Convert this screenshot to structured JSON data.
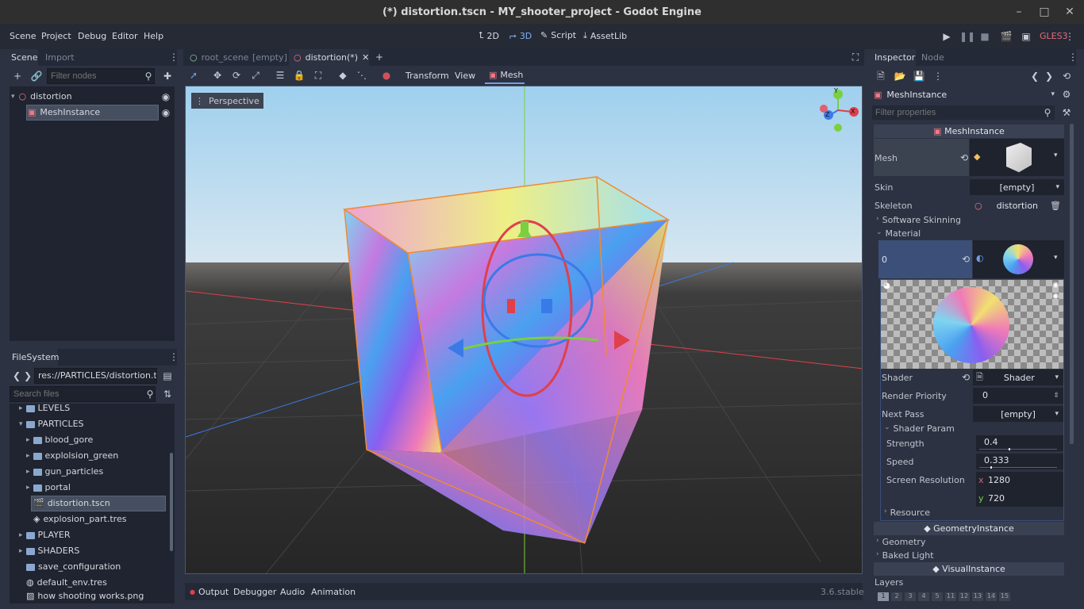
{
  "window": {
    "title": "(*) distortion.tscn - MY_shooter_project - Godot Engine",
    "controls": [
      "–",
      "□",
      "✕"
    ]
  },
  "menu": {
    "items": [
      "Scene",
      "Project",
      "Debug",
      "Editor",
      "Help"
    ]
  },
  "modes": {
    "d2": "2D",
    "d3": "3D",
    "script": "Script",
    "assetlib": "AssetLib"
  },
  "renderer": "GLES3",
  "scene_panel": {
    "tab_scene": "Scene",
    "tab_import": "Import",
    "filter_placeholder": "Filter nodes",
    "nodes": [
      {
        "name": "distortion"
      },
      {
        "name": "MeshInstance"
      }
    ]
  },
  "filesystem": {
    "tab": "FileSystem",
    "path": "res://PARTICLES/distortion.tscn",
    "search_placeholder": "Search files",
    "items": [
      {
        "name": "LEVELS",
        "type": "folder"
      },
      {
        "name": "PARTICLES",
        "type": "folder"
      },
      {
        "name": "blood_gore",
        "type": "folder"
      },
      {
        "name": "explolsion_green",
        "type": "folder"
      },
      {
        "name": "gun_particles",
        "type": "folder"
      },
      {
        "name": "portal",
        "type": "folder"
      },
      {
        "name": "distortion.tscn",
        "type": "scene"
      },
      {
        "name": "explosion_part.tres",
        "type": "resource"
      },
      {
        "name": "PLAYER",
        "type": "folder"
      },
      {
        "name": "SHADERS",
        "type": "folder"
      },
      {
        "name": "save_configuration",
        "type": "folder"
      },
      {
        "name": "default_env.tres",
        "type": "resource"
      },
      {
        "name": "how shooting works.png",
        "type": "image"
      }
    ]
  },
  "editor_tabs": [
    {
      "label": "root_scene"
    },
    {
      "label": "[empty]"
    },
    {
      "label": "distortion(*)"
    }
  ],
  "viewport_toolbar": {
    "transform": "Transform",
    "view": "View",
    "mesh": "Mesh"
  },
  "viewport": {
    "perspective": "Perspective",
    "gizmo": {
      "y": "Y",
      "x": "X",
      "z": "Z"
    }
  },
  "bottom_bar": {
    "output": "Output",
    "debugger": "Debugger",
    "audio": "Audio",
    "animation": "Animation",
    "version": "3.6.stable"
  },
  "inspector": {
    "tab_inspector": "Inspector",
    "tab_node": "Node",
    "node_type": "MeshInstance",
    "filter_placeholder": "Filter properties",
    "section_meshinstance": "MeshInstance",
    "mesh_label": "Mesh",
    "skin_label": "Skin",
    "skin_value": "[empty]",
    "skeleton_label": "Skeleton",
    "skeleton_value": "distortion",
    "software_skinning": "Software Skinning",
    "material": "Material",
    "material_index": "0",
    "shader_label": "Shader",
    "shader_value": "Shader",
    "render_priority_label": "Render Priority",
    "render_priority_value": "0",
    "next_pass_label": "Next Pass",
    "next_pass_value": "[empty]",
    "shader_param": "Shader Param",
    "strength_label": "Strength",
    "strength_value": "0.4",
    "speed_label": "Speed",
    "speed_value": "0.333",
    "screen_res_label": "Screen Resolution",
    "res_x_label": "x",
    "res_x": "1280",
    "res_y_label": "y",
    "res_y": "720",
    "resource": "Resource",
    "geometry_instance": "GeometryInstance",
    "geometry": "Geometry",
    "baked_light": "Baked Light",
    "visual_instance": "VisualInstance",
    "layers": "Layers",
    "layer_numbers": [
      "1",
      "2",
      "3",
      "4",
      "5",
      "11",
      "12",
      "13",
      "14",
      "15"
    ]
  },
  "colors": {
    "accent": "#6fa0e8",
    "renderer": "#e86a7a",
    "bg": "#2c3242",
    "panel": "#232937"
  }
}
